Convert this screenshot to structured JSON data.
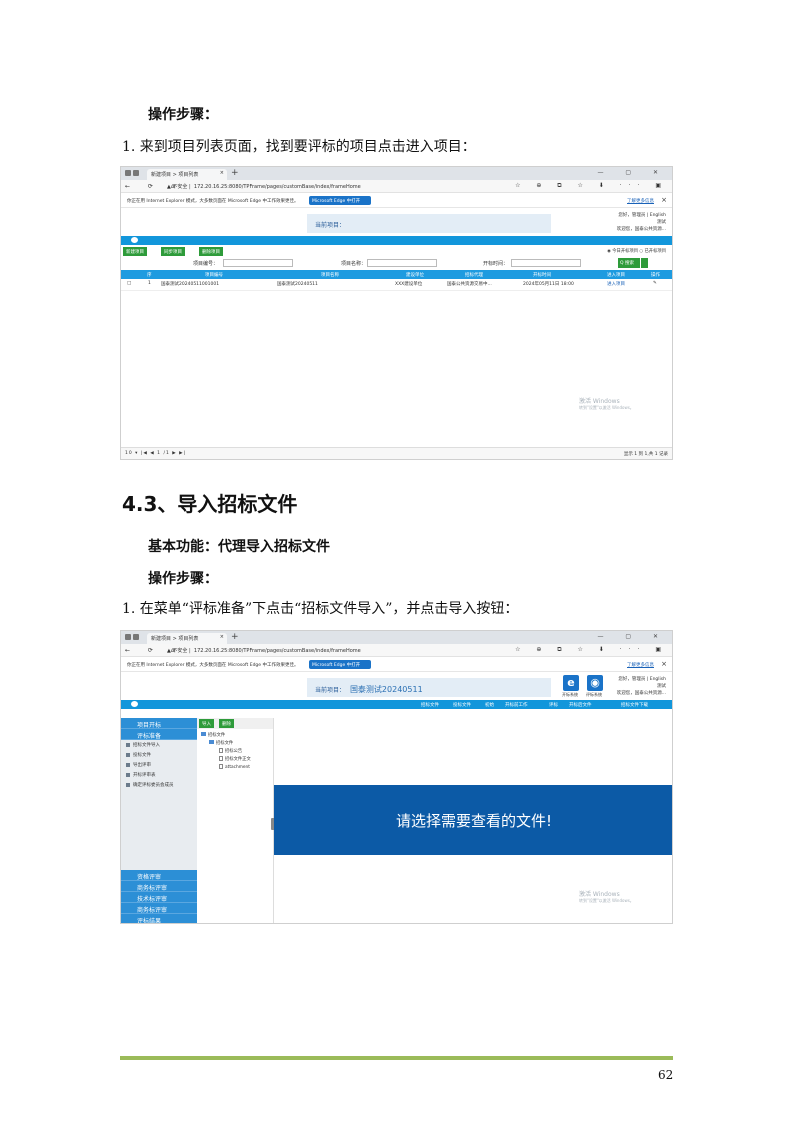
{
  "doc": {
    "steps_heading_1": "操作步骤：",
    "step_1": "1.  来到项目列表页面，找到要评标的项目点击进入项目：",
    "section_title": "4.3、导入招标文件",
    "basic_function": "基本功能：代理导入招标文件",
    "steps_heading_2": "操作步骤：",
    "step_2": "1.  在菜单“评标准备”下点击“招标文件导入”，并点击导入按钮：",
    "page_number": "62",
    "footer_color": "#9bbb59"
  },
  "browser": {
    "tab_title": "新建项目 > 项目列表",
    "tab_close": "×",
    "new_tab": "+",
    "window_controls": "—  ▢  ✕",
    "nav_icons": "← ⟳ ⌂",
    "not_secure": "▲ 不安全",
    "url": "172.20.16.25:8080/TPFrame/pages/customBase/index/frameHome",
    "right_tools": "☆ ⊕ ⧉ ☆ ⬇ ··· ▣",
    "ie_message": "你正在用 Internet Explorer 模式，大多数页面在 Microsoft Edge 中工作效果更佳。",
    "edge_button": "Microsoft Edge 中打开",
    "learn_more": "了解更多信息",
    "close": "×"
  },
  "shot1": {
    "current_project_label": "当前项目：",
    "user_line1": "您好，管理员 | English",
    "user_line2": "测试",
    "user_line3": "欢迎您，国泰公共资源...",
    "buttons": [
      "新建项目",
      "同步项目",
      "删除项目"
    ],
    "radio": "◉ 今日开标项目  ○ 已开标项目",
    "filters": {
      "project_no": "项目编号：",
      "project_name": "项目名称：",
      "bid_time": "开标时间："
    },
    "search": "Q 搜索",
    "columns": [
      "",
      "序",
      "项目编号",
      "项目名称",
      "建设单位",
      "招标代理",
      "开标时间",
      "进入项目",
      "操作"
    ],
    "rows": [
      [
        "□",
        "1",
        "国泰测试20240511001001",
        "国泰测试20240511",
        "XXX建设单位",
        "国泰公共资源交易中...",
        "2024年05月11日 18:00",
        "进入项目",
        "✎"
      ]
    ],
    "watermark_title": "激活 Windows",
    "watermark_sub": "转到\"设置\"以激活 Windows。",
    "pager_left": "10 ▾  |◀ ◀  1  /1  ▶ ▶|",
    "pager_right": "显示 1 到 1,共 1 记录"
  },
  "shot2": {
    "current_project_label": "当前项目：",
    "project_name": "国泰测试20240511",
    "badge1": "e",
    "badge1_label": "开标系统",
    "badge2": "◉",
    "badge2_label": "评标系统",
    "user_line1": "您好，管理员 | English",
    "user_line2": "测试",
    "user_line3": "欢迎您，国泰公共资源...",
    "menu": [
      "招标文件",
      "投标文件",
      "初始",
      "开标前工作",
      "评标",
      "开标后文件",
      "招标文件下载"
    ],
    "left_nav_top": [
      "项目开标",
      "评标准备"
    ],
    "left_nav_sub": [
      "招标文件导入",
      "投标文件",
      "导出评审",
      "开标评审表",
      "确定评标委员会成员"
    ],
    "left_nav_bottom": [
      "资格评审",
      "商务标评审",
      "技术标评审",
      "商务标评审",
      "评标结果"
    ],
    "tree_buttons": [
      "导入",
      "删除"
    ],
    "tree": {
      "root": "招标文件",
      "child": "招标文件",
      "files": [
        "招标公告",
        "招标文件正文",
        "attachment"
      ]
    },
    "viewer_message": "请选择需要查看的文件!",
    "watermark_title": "激活 Windows",
    "watermark_sub": "转到\"设置\"以激活 Windows。"
  }
}
